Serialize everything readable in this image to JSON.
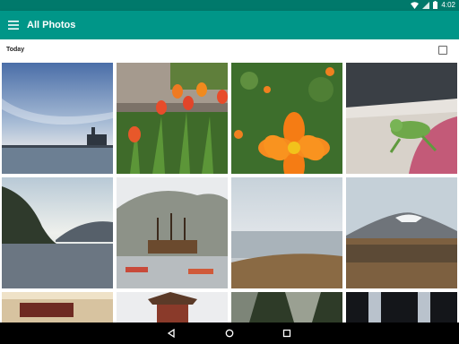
{
  "status_bar": {
    "time": "4:02",
    "icons": [
      "wifi-icon",
      "signal-icon",
      "battery-icon"
    ]
  },
  "app_bar": {
    "title": "All Photos",
    "menu_icon": "hamburger-menu-icon"
  },
  "section": {
    "label": "Today",
    "select_icon": "checkbox-icon"
  },
  "photos": [
    {
      "subject": "harbor-sunset"
    },
    {
      "subject": "red-tulips"
    },
    {
      "subject": "orange-cosmos-flower"
    },
    {
      "subject": "green-tree-frog"
    },
    {
      "subject": "lake-hills"
    },
    {
      "subject": "pirate-ship-harbor"
    },
    {
      "subject": "misty-lake-field"
    },
    {
      "subject": "snowy-mountain-field"
    },
    {
      "subject": "interior-room"
    },
    {
      "subject": "pagoda"
    },
    {
      "subject": "cliffs"
    },
    {
      "subject": "twin-towers-night"
    }
  ],
  "nav_bar": {
    "back_icon": "back-triangle-icon",
    "home_icon": "home-circle-icon",
    "recents_icon": "recents-square-icon"
  },
  "colors": {
    "status_bar": "#00796b",
    "app_bar": "#009688",
    "nav_bar": "#000000"
  }
}
